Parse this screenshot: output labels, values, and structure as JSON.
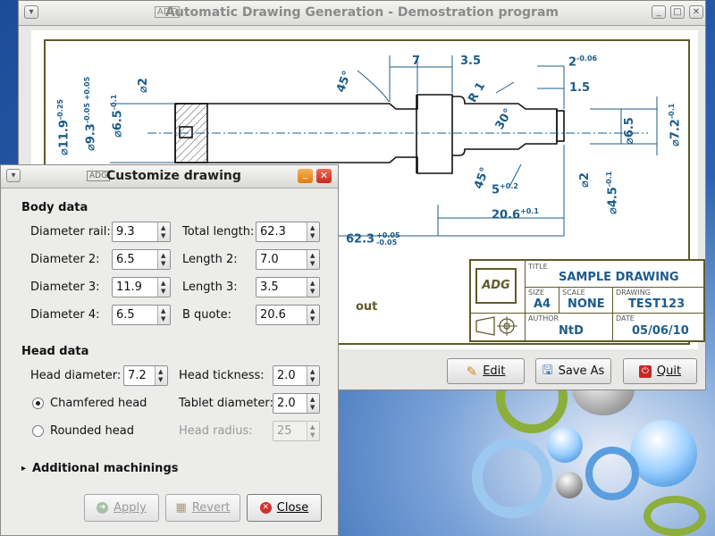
{
  "main_window": {
    "title": "Automatic Drawing Generation - Demostration program",
    "buttons": {
      "edit": "Edit",
      "save_as": "Save As",
      "quit": "Quit"
    }
  },
  "drawing": {
    "dims": {
      "d7": "7",
      "d35": "3.5",
      "d2top": "2",
      "d2top_tol": "-0.06",
      "d15": "1.5",
      "r1": "R 1",
      "a45top": "45°",
      "a30": "30°",
      "a45bot": "45°",
      "d5": "5",
      "d5_tol": "+0.2",
      "d206": "20.6",
      "d206_tol": "+0.1",
      "d623": "62.3",
      "d623_tol_up": "+0.05",
      "d623_tol_dn": "-0.05",
      "left_119": "⌀11.9",
      "left_119_tol": "-0.25",
      "left_93": "⌀9.3",
      "left_93_tol": "-0.05 +0.05",
      "left_65": "⌀6.5",
      "left_65_tol": "-0.1",
      "left_2": "⌀2",
      "right_65": "⌀6.5",
      "right_72": "⌀7.2",
      "right_72_tol": "-0.1",
      "right_2": "⌀2",
      "right_45": "⌀4.5",
      "right_45_tol": "-0.1",
      "out_text": "out"
    },
    "title_block": {
      "title_label": "TITLE",
      "title": "SAMPLE DRAWING",
      "size_label": "SIZE",
      "size": "A4",
      "scale_label": "SCALE",
      "scale": "NONE",
      "drawing_label": "DRAWING",
      "drawing": "TEST123",
      "author_label": "AUTHOR",
      "author": "NtD",
      "date_label": "DATE",
      "date": "05/06/10",
      "logo": "ADG"
    }
  },
  "dialog": {
    "title": "Customize drawing",
    "body_section": "Body data",
    "head_section": "Head data",
    "body": {
      "diameter_rail_label": "Diameter rail:",
      "diameter_rail": "9.3",
      "diameter2_label": "Diameter 2:",
      "diameter2": "6.5",
      "diameter3_label": "Diameter 3:",
      "diameter3": "11.9",
      "diameter4_label": "Diameter 4:",
      "diameter4": "6.5",
      "total_length_label": "Total length:",
      "total_length": "62.3",
      "length2_label": "Length 2:",
      "length2": "7.0",
      "length3_label": "Length 3:",
      "length3": "3.5",
      "b_quote_label": "B quote:",
      "b_quote": "20.6"
    },
    "head": {
      "head_diameter_label": "Head diameter:",
      "head_diameter": "7.2",
      "head_thickness_label": "Head tickness:",
      "head_thickness": "2.0",
      "tablet_diameter_label": "Tablet diameter:",
      "tablet_diameter": "2.0",
      "head_radius_label": "Head radius:",
      "head_radius": "25",
      "chamfered_label": "Chamfered head",
      "rounded_label": "Rounded head",
      "selected": "Chamfered head"
    },
    "expander": "Additional machinings",
    "buttons": {
      "apply": "Apply",
      "revert": "Revert",
      "close": "Close"
    }
  }
}
